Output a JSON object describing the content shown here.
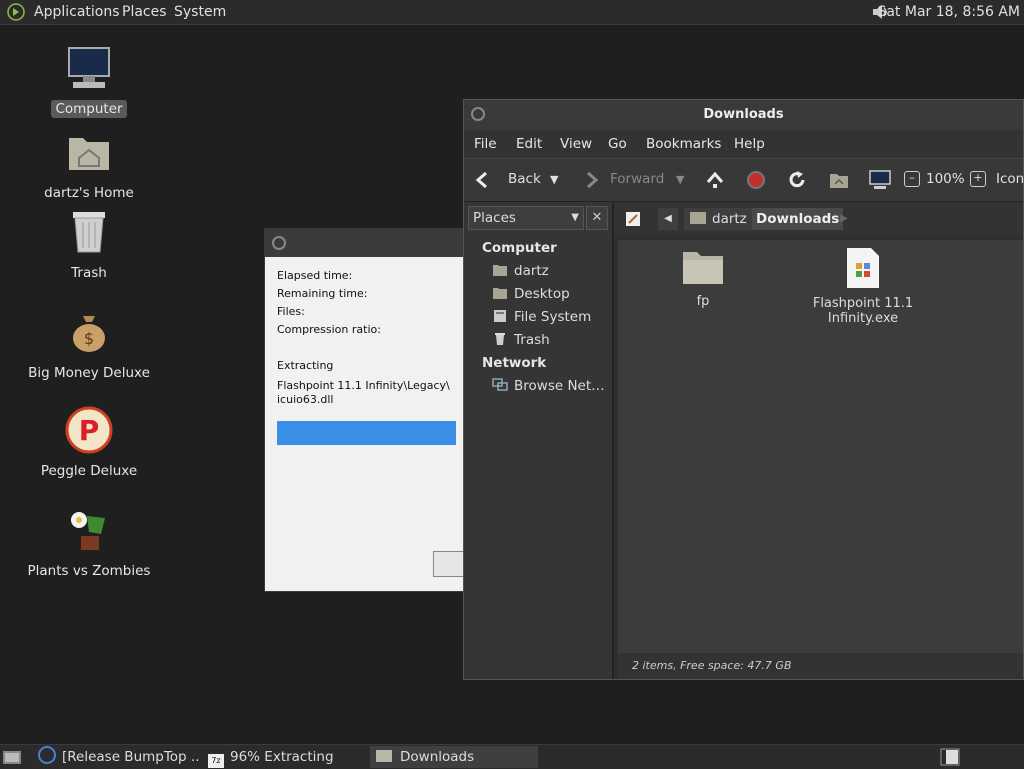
{
  "top_panel": {
    "menus": [
      "Applications",
      "Places",
      "System"
    ],
    "clock": "Sat Mar 18,  8:56 AM"
  },
  "desktop": {
    "icons": [
      {
        "label": "Computer",
        "icon": "computer-icon"
      },
      {
        "label": "dartz's Home",
        "icon": "home-folder-icon"
      },
      {
        "label": "Trash",
        "icon": "trash-icon"
      },
      {
        "label": "Big Money Deluxe",
        "icon": "money-bag-icon"
      },
      {
        "label": "Peggle Deluxe",
        "icon": "peggle-icon"
      },
      {
        "label": "Plants vs Zombies",
        "icon": "plants-vs-zombies-icon"
      }
    ]
  },
  "extract_dialog": {
    "fields": [
      "Elapsed time:",
      "Remaining time:",
      "Files:",
      "Compression ratio:"
    ],
    "status": "Extracting",
    "path_line1": "Flashpoint 11.1 Infinity\\Legacy\\",
    "path_line2": "icuio63.dll",
    "progress": 0.96
  },
  "file_manager": {
    "title": "Downloads",
    "menus": [
      "File",
      "Edit",
      "View",
      "Go",
      "Bookmarks",
      "Help"
    ],
    "toolbar": {
      "back": "Back",
      "forward": "Forward",
      "zoom": "100%",
      "view_mode": "Icon"
    },
    "sidebar": {
      "selector": "Places",
      "close": "✕",
      "computer_heading": "Computer",
      "computer_items": [
        "dartz",
        "Desktop",
        "File System",
        "Trash"
      ],
      "network_heading": "Network",
      "network_items": [
        "Browse Net…"
      ]
    },
    "path": [
      "dartz",
      "Downloads"
    ],
    "files": [
      {
        "name": "fp",
        "type": "folder"
      },
      {
        "name_line1": "Flashpoint 11.1",
        "name_line2": "Infinity.exe",
        "type": "exe"
      }
    ],
    "status": "2 items, Free space: 47.7 GB"
  },
  "taskbar": {
    "tasks": [
      {
        "label": "[Release BumpTop ...",
        "active": false
      },
      {
        "label": "96% Extracting",
        "active": false
      },
      {
        "label": "Downloads",
        "active": true
      }
    ]
  },
  "colors": {
    "progress": "#3b8fe6",
    "panel": "#2b2b2b",
    "desktop": "#1f1f1f"
  }
}
